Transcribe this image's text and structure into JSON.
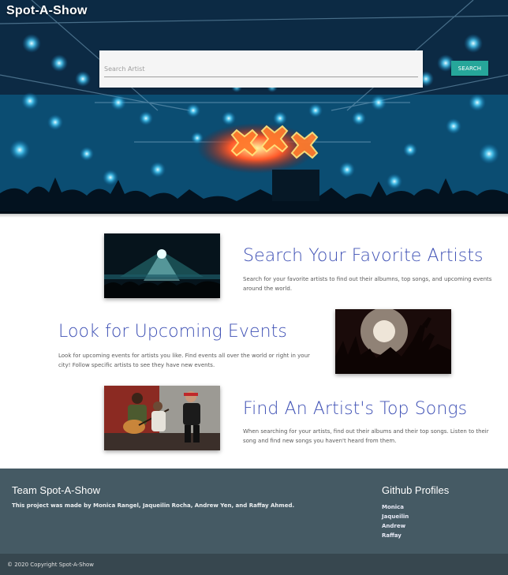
{
  "app": {
    "brand": "Spot-A-Show"
  },
  "search": {
    "placeholder": "Search Artist",
    "value": "",
    "button_label": "SEARCH"
  },
  "features": [
    {
      "title": "Search Your Favorite Artists",
      "description": "Search for your favorite artists to find out their albumns, top songs, and upcoming events around the world.",
      "image": "concert-light-show-photo"
    },
    {
      "title": "Look for Upcoming Events",
      "description": "Look for upcoming events for artists you like. Find events all over the world or right in your city! Follow specific artists to see they have new events.",
      "image": "crowd-hands-photo"
    },
    {
      "title": "Find An Artist's Top Songs",
      "description": "When searching for your artists, find out their albums and their top songs. Listen to their song and find new songs you haven't heard from them.",
      "image": "musicians-guitar-photo"
    }
  ],
  "footer": {
    "team_title": "Team Spot-A-Show",
    "team_text": "This project was made by Monica Rangel, Jaqueilin Rocha, Andrew Yen, and Raffay Ahmed.",
    "github_title": "Github Profiles",
    "github_links": [
      "Monica",
      "Jaqueilin",
      "Andrew",
      "Raffay"
    ],
    "copyright": "© 2020 Copyright Spot-A-Show"
  },
  "colors": {
    "accent": "#3f51b5",
    "button": "#26a69a",
    "footer": "#455a64",
    "footer_bottom": "#37474f"
  }
}
